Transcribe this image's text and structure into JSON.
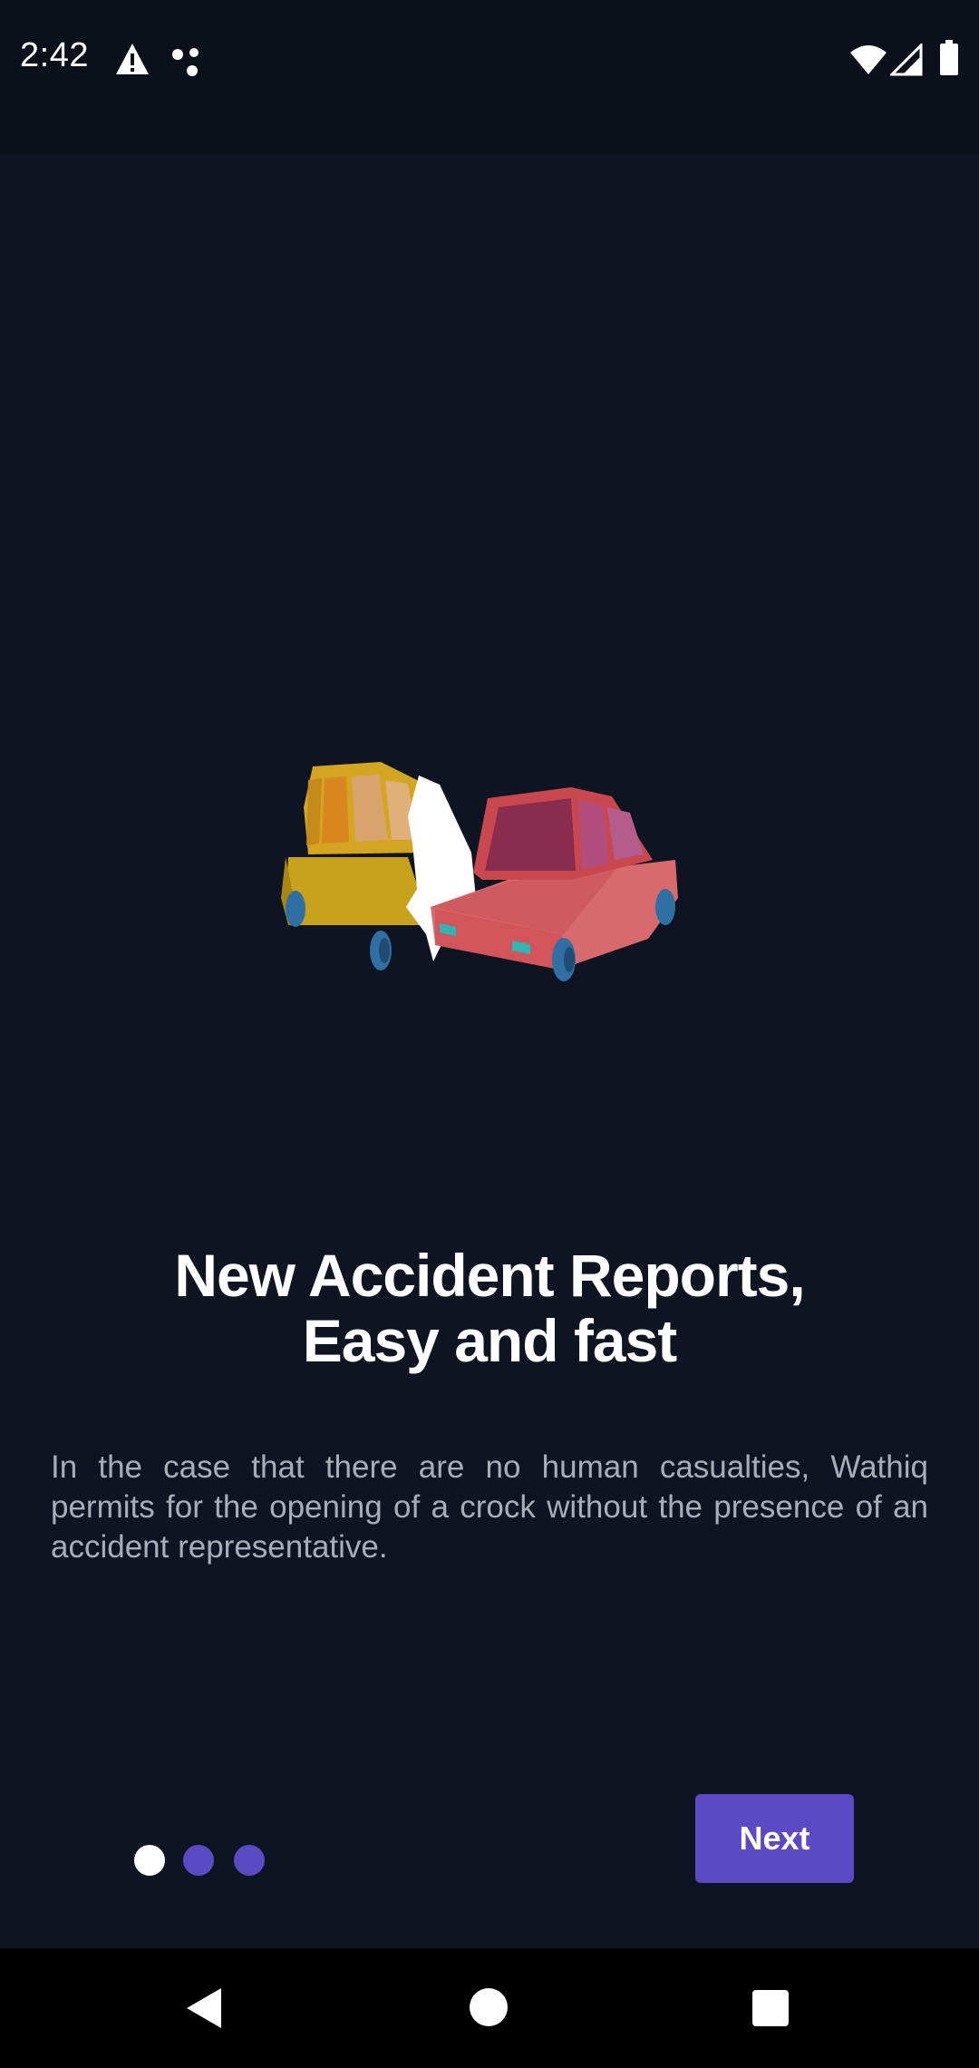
{
  "status_bar": {
    "time": "2:42",
    "icons": [
      "warning-icon",
      "dots-icon",
      "wifi-icon",
      "signal-icon",
      "battery-icon"
    ]
  },
  "onboarding": {
    "illustration": "car-collision-illustration",
    "title_line1": "New Accident Reports,",
    "title_line2": "Easy and fast",
    "description": "In the case that there are no human casualties, Wathiq permits for the opening of a crock without the presence of an accident representative.",
    "page_indicator": {
      "total": 3,
      "current": 1
    },
    "next_label": "Next"
  },
  "colors": {
    "background": "#0e1421",
    "status_bar_bg": "#0b101b",
    "accent": "#5a4ac4",
    "text_primary": "#ffffff",
    "text_secondary": "#a9adb6"
  },
  "nav_bar": {
    "icons": [
      "back-icon",
      "home-icon",
      "recents-icon"
    ]
  }
}
